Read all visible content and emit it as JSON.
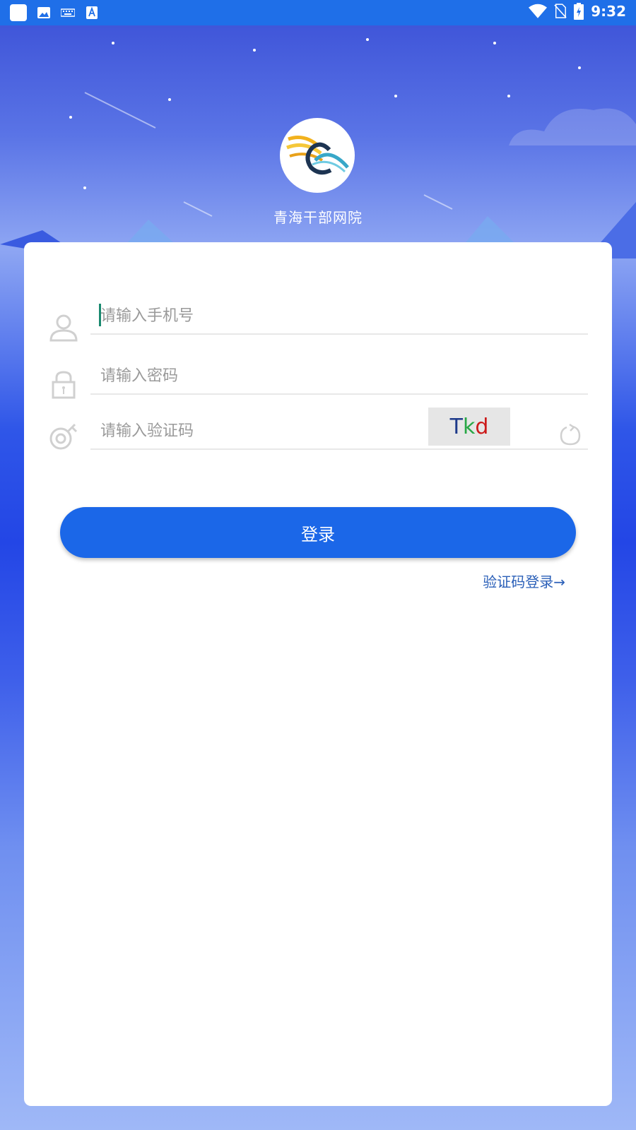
{
  "statusbar": {
    "time": "9:32"
  },
  "app": {
    "name": "青海干部网院"
  },
  "form": {
    "phone_placeholder": "请输入手机号",
    "password_placeholder": "请输入密码",
    "captcha_placeholder": "请输入验证码",
    "captcha_text": [
      "T",
      "k",
      "d"
    ],
    "login_label": "登录",
    "alt_login_label": "验证码登录→"
  },
  "colors": {
    "statusbar": "#1f6fe8",
    "primary": "#1b67e8",
    "link": "#2a5fb8"
  }
}
